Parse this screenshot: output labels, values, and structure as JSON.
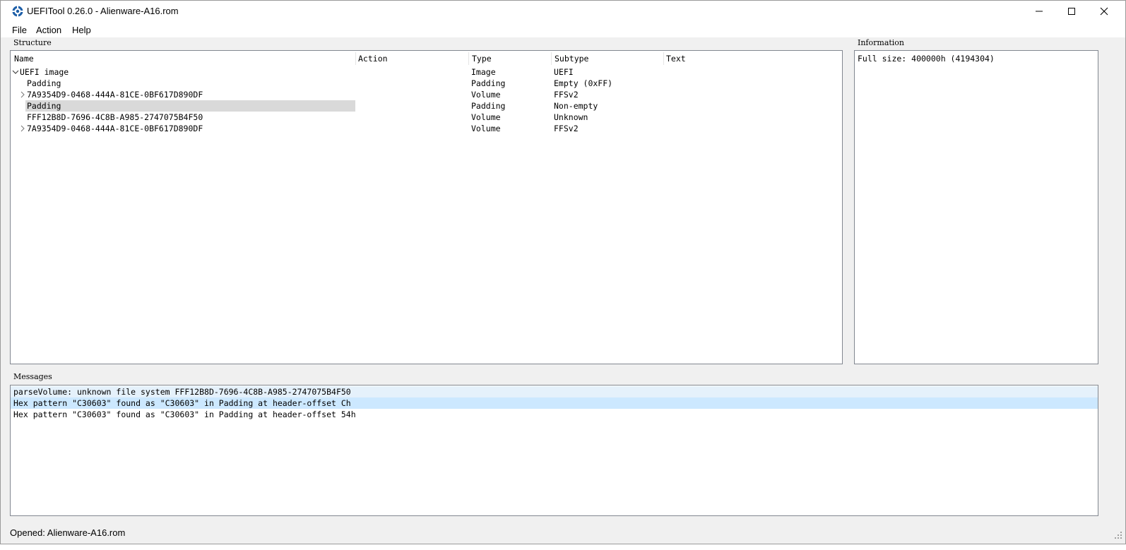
{
  "window": {
    "title": "UEFITool 0.26.0 - Alienware-A16.rom"
  },
  "menu": {
    "file": "File",
    "action": "Action",
    "help": "Help"
  },
  "structure": {
    "group_title": "Structure",
    "columns": [
      "Name",
      "Action",
      "Type",
      "Subtype",
      "Text"
    ],
    "rows": [
      {
        "name": "UEFI image",
        "action": "",
        "type": "Image",
        "subtype": "UEFI",
        "text": ""
      },
      {
        "name": "Padding",
        "action": "",
        "type": "Padding",
        "subtype": "Empty (0xFF)",
        "text": ""
      },
      {
        "name": "7A9354D9-0468-444A-81CE-0BF617D890DF",
        "action": "",
        "type": "Volume",
        "subtype": "FFSv2",
        "text": ""
      },
      {
        "name": "Padding",
        "action": "",
        "type": "Padding",
        "subtype": "Non-empty",
        "text": ""
      },
      {
        "name": "FFF12B8D-7696-4C8B-A985-2747075B4F50",
        "action": "",
        "type": "Volume",
        "subtype": "Unknown",
        "text": ""
      },
      {
        "name": "7A9354D9-0468-444A-81CE-0BF617D890DF",
        "action": "",
        "type": "Volume",
        "subtype": "FFSv2",
        "text": ""
      }
    ],
    "selected_row": 3
  },
  "information": {
    "group_title": "Information",
    "text": "Full size: 400000h (4194304)"
  },
  "messages": {
    "group_title": "Messages",
    "items": [
      "parseVolume: unknown file system FFF12B8D-7696-4C8B-A985-2747075B4F50",
      "Hex pattern \"C30603\" found as \"C30603\" in Padding at header-offset Ch",
      "Hex pattern \"C30603\" found as \"C30603\" in Padding at header-offset 54h"
    ]
  },
  "status": {
    "text": "Opened: Alienware-A16.rom"
  },
  "colors": {
    "selection": "#d9d9d9",
    "message_alt": "#e5f1fb",
    "message_current": "#cce8ff",
    "app_icon": "#1e5fa8"
  }
}
